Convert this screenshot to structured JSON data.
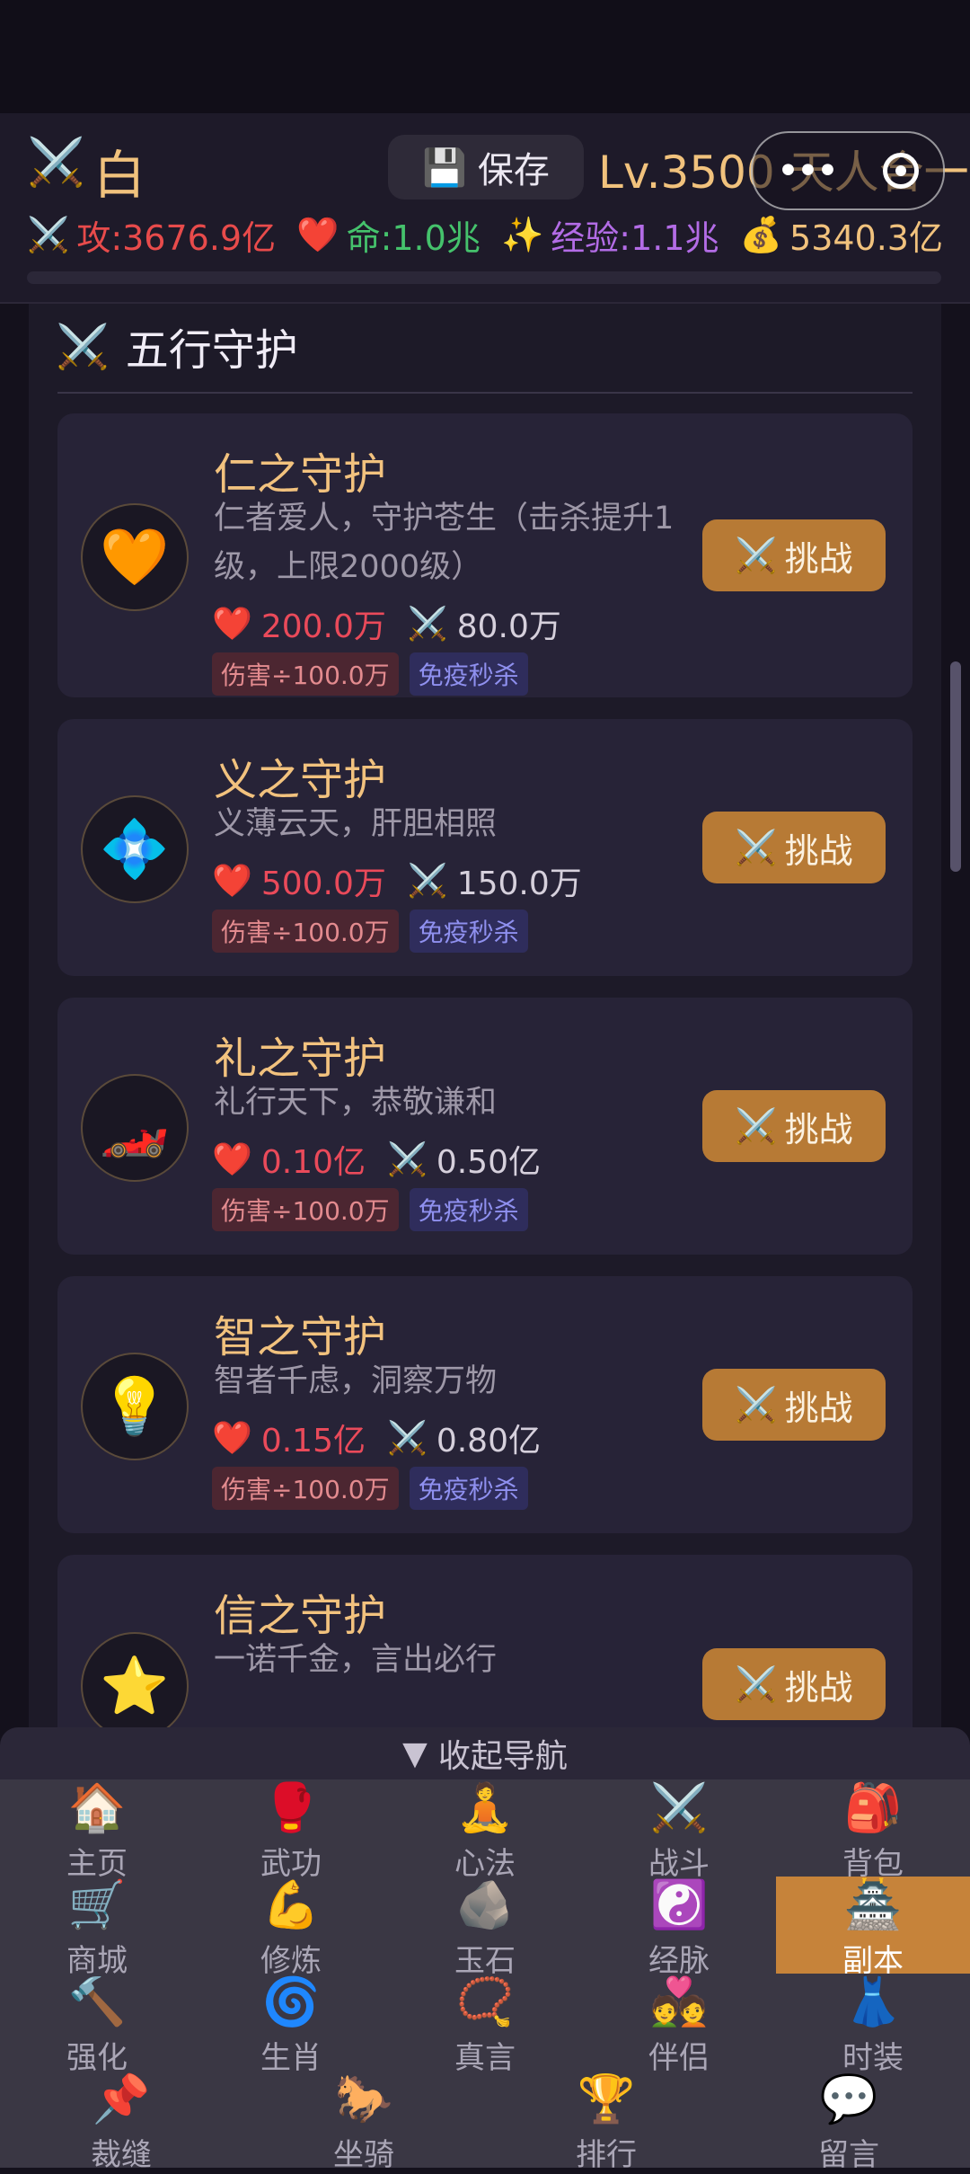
{
  "header": {
    "hero_icon": "⚔️",
    "hero_name": "白",
    "save_icon": "💾",
    "save_label": "保存",
    "level_text": "Lv.3500 天人合一",
    "capsule_dots": "•••",
    "stats": [
      {
        "icon": "⚔️",
        "text": "攻:3676.9亿",
        "color": "#e84b4b"
      },
      {
        "icon": "❤️",
        "text": "命:1.0兆",
        "color": "#45c26c"
      },
      {
        "icon": "✨",
        "text": "经验:1.1兆",
        "color": "#b36ce6"
      },
      {
        "icon": "💰",
        "text": "5340.3亿",
        "color": "#f1c27d"
      }
    ]
  },
  "section": {
    "icon": "⚔️",
    "title": "五行守护"
  },
  "guardians": [
    {
      "icon": "🧡",
      "name": "仁之守护",
      "desc": "仁者爱人，守护苍生（击杀提升1级，上限2000级）",
      "hp": "200.0万",
      "atk": "80.0万",
      "tag_damage": "伤害÷100.0万",
      "tag_immune": "免疫秒杀",
      "button": "挑战"
    },
    {
      "icon": "💠",
      "name": "义之守护",
      "desc": "义薄云天，肝胆相照",
      "hp": "500.0万",
      "atk": "150.0万",
      "tag_damage": "伤害÷100.0万",
      "tag_immune": "免疫秒杀",
      "button": "挑战"
    },
    {
      "icon": "🏎️",
      "name": "礼之守护",
      "desc": "礼行天下，恭敬谦和",
      "hp": "0.10亿",
      "atk": "0.50亿",
      "tag_damage": "伤害÷100.0万",
      "tag_immune": "免疫秒杀",
      "button": "挑战"
    },
    {
      "icon": "💡",
      "name": "智之守护",
      "desc": "智者千虑，洞察万物",
      "hp": "0.15亿",
      "atk": "0.80亿",
      "tag_damage": "伤害÷100.0万",
      "tag_immune": "免疫秒杀",
      "button": "挑战"
    },
    {
      "icon": "⭐",
      "name": "信之守护",
      "desc": "一诺千金，言出必行",
      "hp": "",
      "atk": "",
      "tag_damage": "",
      "tag_immune": "",
      "button": "挑战"
    }
  ],
  "collapse": {
    "icon": "▼",
    "label": "收起导航"
  },
  "nav": {
    "rows": [
      [
        {
          "icon": "🏠",
          "label": "主页"
        },
        {
          "icon": "🥊",
          "label": "武功"
        },
        {
          "icon": "🧘",
          "label": "心法"
        },
        {
          "icon": "⚔️",
          "label": "战斗"
        },
        {
          "icon": "🎒",
          "label": "背包"
        }
      ],
      [
        {
          "icon": "🛒",
          "label": "商城"
        },
        {
          "icon": "💪",
          "label": "修炼"
        },
        {
          "icon": "🪨",
          "label": "玉石"
        },
        {
          "icon": "☯️",
          "label": "经脉"
        },
        {
          "icon": "🏯",
          "label": "副本",
          "active": true
        }
      ],
      [
        {
          "icon": "🔨",
          "label": "强化"
        },
        {
          "icon": "🌀",
          "label": "生肖"
        },
        {
          "icon": "📿",
          "label": "真言"
        },
        {
          "icon": "💑",
          "label": "伴侣"
        },
        {
          "icon": "👗",
          "label": "时装"
        }
      ],
      [
        {
          "icon": "📌",
          "label": "裁缝"
        },
        {
          "icon": "🐎",
          "label": "坐骑"
        },
        {
          "icon": "🏆",
          "label": "排行"
        },
        {
          "icon": "💬",
          "label": "留言"
        }
      ]
    ]
  }
}
